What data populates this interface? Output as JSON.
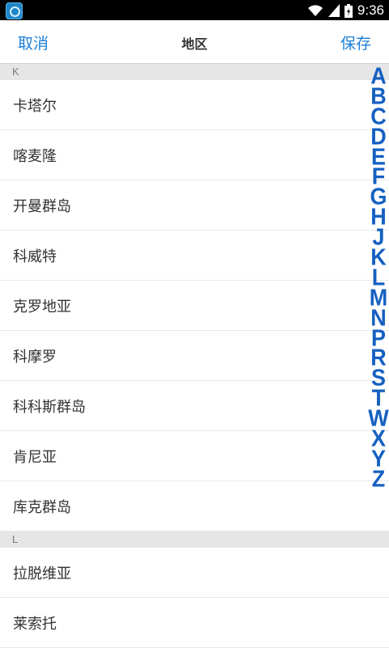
{
  "status_bar": {
    "time": "9:36"
  },
  "nav": {
    "cancel_label": "取消",
    "title": "地区",
    "save_label": "保存"
  },
  "sections": [
    {
      "header": "K",
      "items": [
        "卡塔尔",
        "喀麦隆",
        "开曼群岛",
        "科威特",
        "克罗地亚",
        "科摩罗",
        "科科斯群岛",
        "肯尼亚",
        "库克群岛"
      ]
    },
    {
      "header": "L",
      "items": [
        "拉脱维亚",
        "莱索托"
      ]
    }
  ],
  "index_letters": [
    "A",
    "B",
    "C",
    "D",
    "E",
    "F",
    "G",
    "H",
    "J",
    "K",
    "L",
    "M",
    "N",
    "P",
    "R",
    "S",
    "T",
    "W",
    "X",
    "Y",
    "Z"
  ],
  "colors": {
    "accent": "#1c7fd6",
    "index": "#1560c1",
    "section_bg": "#e6e6e6"
  }
}
